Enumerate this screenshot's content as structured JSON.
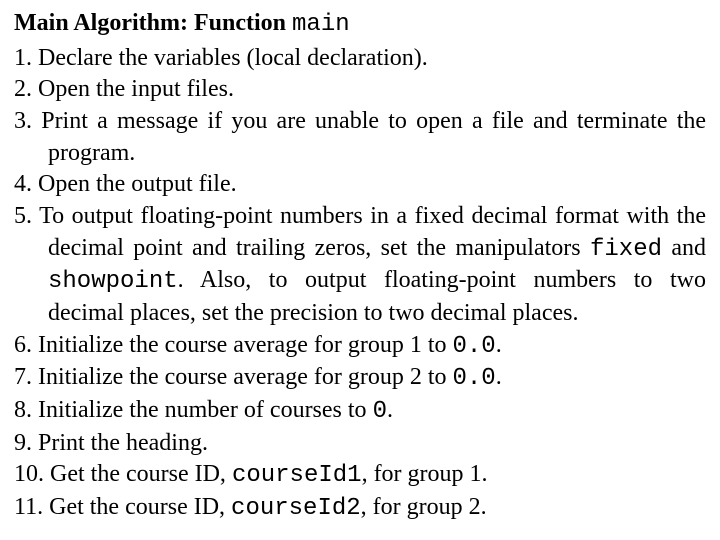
{
  "title_prefix": "Main Algorithm: Function ",
  "title_fn": "main",
  "steps": [
    {
      "n": "1.",
      "segs": [
        {
          "t": "Declare the variables (local declaration)."
        }
      ]
    },
    {
      "n": "2.",
      "segs": [
        {
          "t": "Open the input files."
        }
      ]
    },
    {
      "n": "3.",
      "segs": [
        {
          "t": "Print a message if you are unable to open a file and terminate the program."
        }
      ]
    },
    {
      "n": "4.",
      "segs": [
        {
          "t": "Open the output file."
        }
      ]
    },
    {
      "n": "5.",
      "segs": [
        {
          "t": "To output floating-point numbers in a fixed decimal format with the decimal point and trailing zeros, set the manipulators "
        },
        {
          "t": "fixed",
          "mono": true
        },
        {
          "t": " and "
        },
        {
          "t": "showpoint",
          "mono": true
        },
        {
          "t": ". Also, to output floating-point numbers to two decimal places, set the precision to two decimal places."
        }
      ]
    },
    {
      "n": "6.",
      "segs": [
        {
          "t": "Initialize the course average for group 1 to "
        },
        {
          "t": "0.0",
          "mono": true
        },
        {
          "t": "."
        }
      ]
    },
    {
      "n": "7.",
      "segs": [
        {
          "t": "Initialize the course average for group 2 to "
        },
        {
          "t": "0.0",
          "mono": true
        },
        {
          "t": "."
        }
      ]
    },
    {
      "n": "8.",
      "segs": [
        {
          "t": "Initialize the number of courses to "
        },
        {
          "t": "0",
          "mono": true
        },
        {
          "t": "."
        }
      ]
    },
    {
      "n": "9.",
      "segs": [
        {
          "t": "Print the heading."
        }
      ]
    },
    {
      "n": "10.",
      "segs": [
        {
          "t": "Get the course ID, "
        },
        {
          "t": "courseId1",
          "mono": true
        },
        {
          "t": ", for group 1."
        }
      ]
    },
    {
      "n": "11.",
      "segs": [
        {
          "t": "Get the course ID, "
        },
        {
          "t": "courseId2",
          "mono": true
        },
        {
          "t": ", for group 2."
        }
      ]
    }
  ]
}
